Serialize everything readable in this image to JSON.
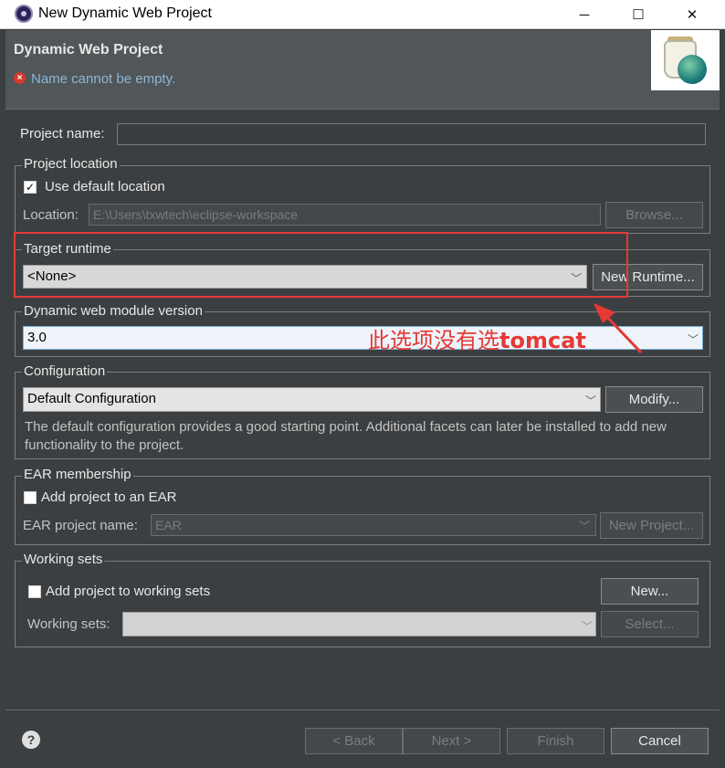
{
  "window": {
    "title": "New Dynamic Web Project",
    "min_glyph": "─",
    "max_glyph": "☐",
    "close_glyph": "✕"
  },
  "header": {
    "title": "Dynamic Web Project",
    "error_glyph": "×",
    "error_message": "Name cannot be empty."
  },
  "project_name": {
    "label": "Project name:",
    "value": ""
  },
  "project_location": {
    "legend": "Project location",
    "use_default_checked": true,
    "use_default_label": "Use default location",
    "location_label": "Location:",
    "location_value": "E:\\Users\\txwtech\\eclipse-workspace",
    "browse_label": "Browse..."
  },
  "target_runtime": {
    "legend": "Target runtime",
    "selected": "<None>",
    "new_runtime_label": "New Runtime..."
  },
  "module_version": {
    "legend": "Dynamic web module version",
    "selected": "3.0"
  },
  "configuration": {
    "legend": "Configuration",
    "selected": "Default Configuration",
    "modify_label": "Modify...",
    "description": "The default configuration provides a good starting point. Additional facets can later be installed to add new functionality to the project."
  },
  "ear": {
    "legend": "EAR membership",
    "add_checked": false,
    "add_label": "Add project to an EAR",
    "project_name_label": "EAR project name:",
    "project_name_value": "EAR",
    "new_project_label": "New Project..."
  },
  "working_sets": {
    "legend": "Working sets",
    "add_checked": false,
    "add_label": "Add project to working sets",
    "new_label": "New...",
    "sets_label": "Working sets:",
    "select_label": "Select..."
  },
  "footer": {
    "help_glyph": "?",
    "back_label": "< Back",
    "next_label": "Next >",
    "finish_label": "Finish",
    "cancel_label": "Cancel"
  },
  "annotation": {
    "text": "此选项没有选",
    "text_bold": "tomcat",
    "color": "#e53935"
  },
  "icons": [
    "eclipse-app-icon",
    "error-icon",
    "checkbox-check-icon",
    "chevron-down-icon",
    "help-icon",
    "jar-globe-banner-icon"
  ]
}
